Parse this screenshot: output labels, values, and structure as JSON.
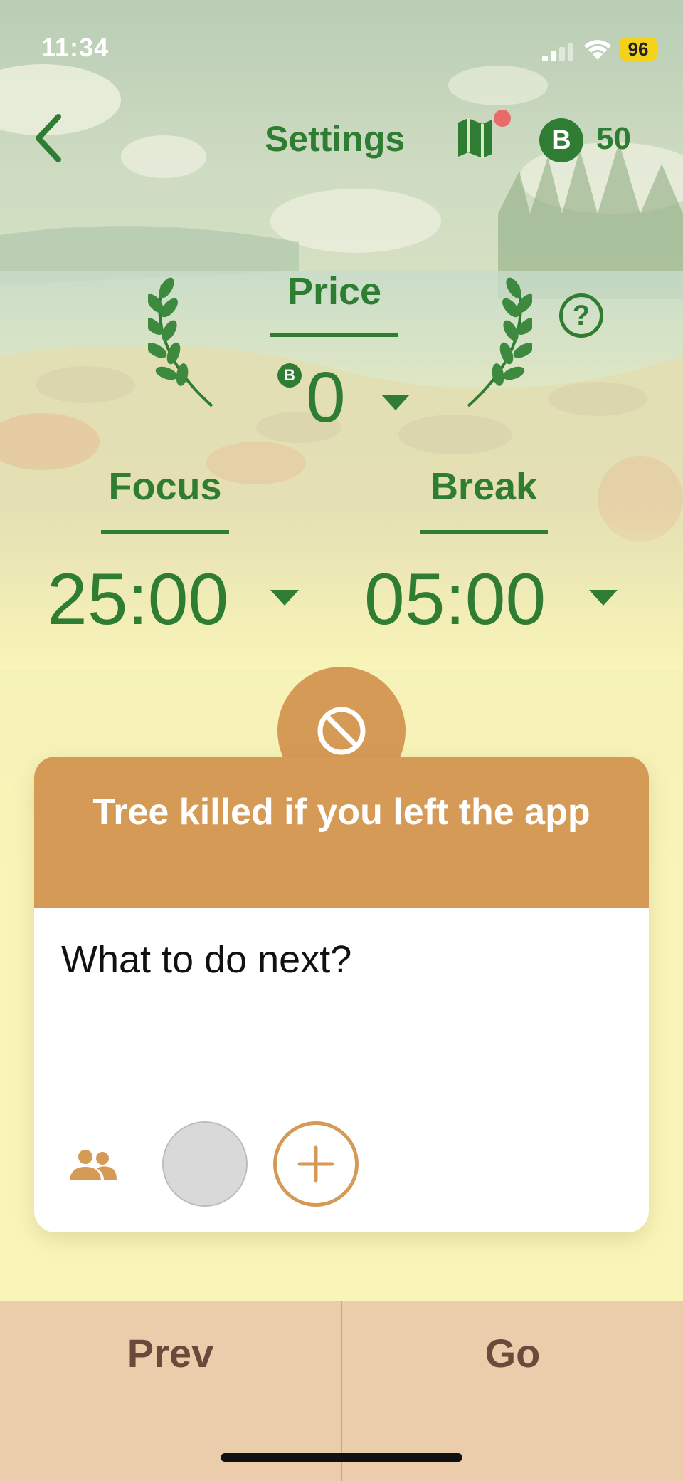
{
  "status_bar": {
    "time": "11:34",
    "battery": "96"
  },
  "nav": {
    "title": "Settings",
    "coin_count": "50",
    "coin_letter": "B"
  },
  "price": {
    "label": "Price",
    "coin_letter": "B",
    "value": "0"
  },
  "focus": {
    "label": "Focus",
    "value": "25:00"
  },
  "break": {
    "label": "Break",
    "value": "05:00"
  },
  "help": {
    "symbol": "?"
  },
  "mode_card": {
    "title": "Tree killed if you left the app",
    "question": "What to do next?"
  },
  "bottom": {
    "prev_label": "Prev",
    "go_label": "Go"
  },
  "colors": {
    "accent_green": "#2f7d32",
    "card_orange": "#d69a57",
    "bottom_bar": "#ebcdab",
    "background": "#f9f5b8"
  }
}
